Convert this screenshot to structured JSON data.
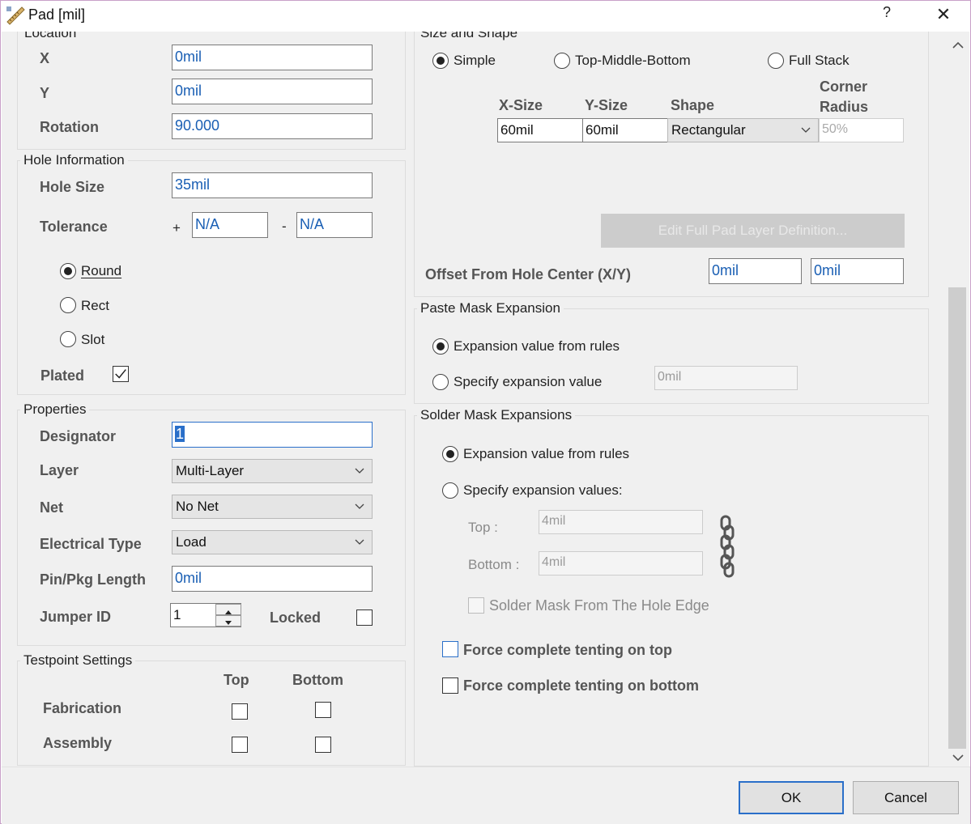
{
  "window": {
    "title": "Pad [mil]",
    "help": "?",
    "close": "✕"
  },
  "location": {
    "title": "Location",
    "x_label": "X",
    "x_value": "0mil",
    "y_label": "Y",
    "y_value": "0mil",
    "rotation_label": "Rotation",
    "rotation_value": "90.000"
  },
  "hole": {
    "title": "Hole Information",
    "size_label": "Hole Size",
    "size_value": "35mil",
    "tolerance_label": "Tolerance",
    "plus": "+",
    "minus": "-",
    "tol_plus": "N/A",
    "tol_minus": "N/A",
    "round": "Round",
    "rect": "Rect",
    "slot": "Slot",
    "plated_label": "Plated"
  },
  "properties": {
    "title": "Properties",
    "designator_label": "Designator",
    "designator_value": "1",
    "layer_label": "Layer",
    "layer_value": "Multi-Layer",
    "net_label": "Net",
    "net_value": "No Net",
    "etype_label": "Electrical Type",
    "etype_value": "Load",
    "pinpkg_label": "Pin/Pkg Length",
    "pinpkg_value": "0mil",
    "jumper_label": "Jumper ID",
    "jumper_value": "1",
    "locked_label": "Locked"
  },
  "testpoint": {
    "title": "Testpoint Settings",
    "col_top": "Top",
    "col_bottom": "Bottom",
    "fab_label": "Fabrication",
    "asm_label": "Assembly"
  },
  "size_shape": {
    "title": "Size and Shape",
    "simple": "Simple",
    "tmb": "Top-Middle-Bottom",
    "full": "Full Stack",
    "col_x": "X-Size",
    "col_y": "Y-Size",
    "col_shape": "Shape",
    "col_corner_1": "Corner",
    "col_corner_2": "Radius",
    "x_value": "60mil",
    "y_value": "60mil",
    "shape_value": "Rectangular",
    "corner_value": "50%",
    "edit_button": "Edit Full Pad Layer Definition...",
    "offset_label": "Offset From Hole Center (X/Y)",
    "offset_x": "0mil",
    "offset_y": "0mil"
  },
  "paste": {
    "title": "Paste Mask Expansion",
    "from_rules": "Expansion value from rules",
    "specify": "Specify expansion value",
    "value": "0mil"
  },
  "solder": {
    "title": "Solder Mask Expansions",
    "from_rules": "Expansion value from rules",
    "specify": "Specify expansion values:",
    "top_label": "Top :",
    "top_value": "4mil",
    "bottom_label": "Bottom :",
    "bottom_value": "4mil",
    "hole_edge": "Solder Mask From The Hole Edge",
    "tent_top": "Force complete tenting on top",
    "tent_bottom": "Force complete tenting on bottom"
  },
  "footer": {
    "ok": "OK",
    "cancel": "Cancel"
  },
  "colors": {
    "accent": "#2a6fc9",
    "value_text": "#1a5fb4",
    "background": "#f0f0f0"
  }
}
